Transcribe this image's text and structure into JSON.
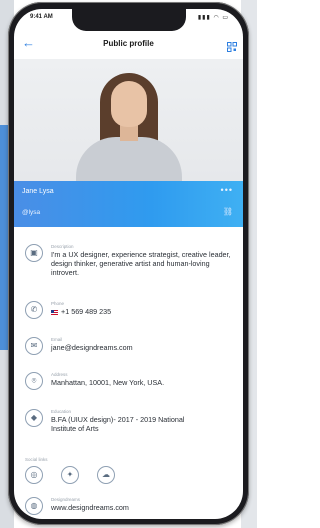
{
  "status": {
    "time": "9:41 AM",
    "icons": "▮▮▮ ◠ ▭"
  },
  "header": {
    "title": "Public profile",
    "back_icon": "arrow-left-icon",
    "qr_icon": "qr-code-icon"
  },
  "profile": {
    "name": "Jane Lysa",
    "handle": "@lysa",
    "more_icon": "•••",
    "link_icon": "⛓"
  },
  "details": [
    {
      "label": "Description",
      "value": "I'm a UX designer, experience strategist, creative leader, design thinker, generative artist and human-loving introvert.",
      "icon": "id-card-icon",
      "glyph": "▣"
    },
    {
      "label": "Phone",
      "value": "+1 569 489 235",
      "icon": "phone-icon",
      "glyph": "✆"
    },
    {
      "label": "Email",
      "value": "jane@designdreams.com",
      "icon": "email-icon",
      "glyph": "✉"
    },
    {
      "label": "Address",
      "value": "Manhattan, 10001, New York, USA.",
      "icon": "location-icon",
      "glyph": "⌾"
    },
    {
      "label": "Education",
      "value": "B.FA (UIUX design)- 2017 - 2019 National Institute of Arts",
      "icon": "education-icon",
      "glyph": "◆"
    }
  ],
  "social": {
    "label": "Social links",
    "links": [
      {
        "icon": "instagram-icon",
        "glyph": "◎"
      },
      {
        "icon": "twitter-icon",
        "glyph": "✦"
      },
      {
        "icon": "snapchat-icon",
        "glyph": "☁"
      }
    ]
  },
  "website": {
    "label": "Designdreams",
    "value": "www.designdreams.com",
    "icon": "globe-icon",
    "glyph": "◍"
  },
  "colors": {
    "accent": "#2f9bef",
    "icon_stroke": "#8fa0b3"
  }
}
